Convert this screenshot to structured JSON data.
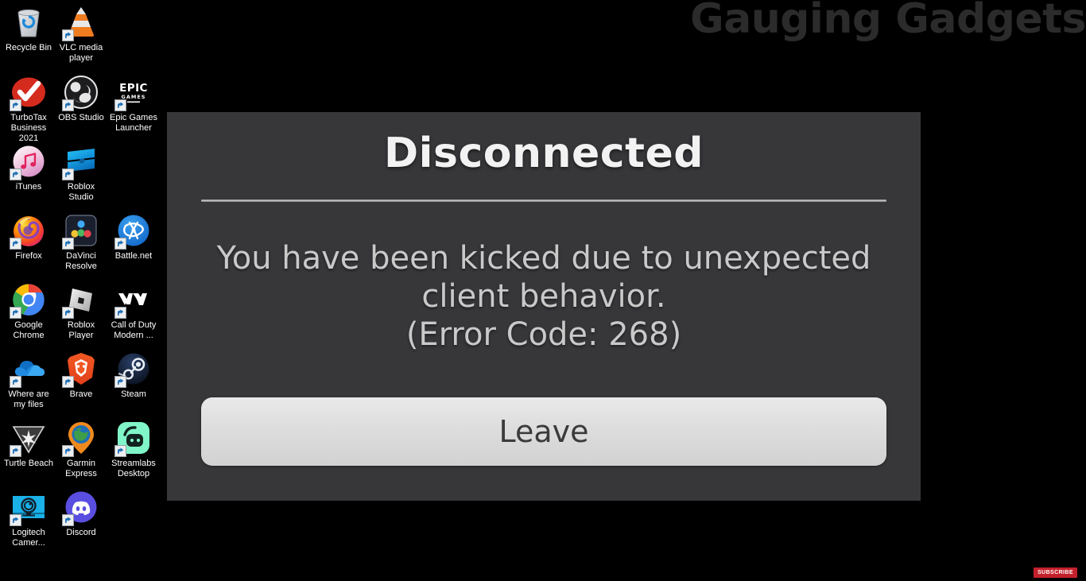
{
  "watermark": {
    "text": "Gauging Gadgets"
  },
  "desktop": {
    "icons": [
      {
        "label": "Recycle Bin",
        "art": "recycle-bin",
        "shortcut": false,
        "col": 0,
        "row": 0
      },
      {
        "label": "VLC media player",
        "art": "vlc",
        "shortcut": true,
        "col": 1,
        "row": 0
      },
      {
        "label": "TurboTax Business 2021",
        "art": "turbotax",
        "shortcut": true,
        "col": 0,
        "row": 1
      },
      {
        "label": "OBS Studio",
        "art": "obs",
        "shortcut": true,
        "col": 1,
        "row": 1
      },
      {
        "label": "Epic Games Launcher",
        "art": "epic-games",
        "shortcut": true,
        "col": 2,
        "row": 1
      },
      {
        "label": "iTunes",
        "art": "itunes",
        "shortcut": true,
        "col": 0,
        "row": 2
      },
      {
        "label": "Roblox Studio",
        "art": "roblox-studio",
        "shortcut": true,
        "col": 1,
        "row": 2
      },
      {
        "label": "Firefox",
        "art": "firefox",
        "shortcut": true,
        "col": 0,
        "row": 3
      },
      {
        "label": "DaVinci Resolve",
        "art": "davinci-resolve",
        "shortcut": true,
        "col": 1,
        "row": 3
      },
      {
        "label": "Battle.net",
        "art": "battle-net",
        "shortcut": true,
        "col": 2,
        "row": 3
      },
      {
        "label": "Google Chrome",
        "art": "chrome",
        "shortcut": true,
        "col": 0,
        "row": 4
      },
      {
        "label": "Roblox Player",
        "art": "roblox-player",
        "shortcut": true,
        "col": 1,
        "row": 4
      },
      {
        "label": "Call of Duty Modern ...",
        "art": "call-of-duty",
        "shortcut": true,
        "col": 2,
        "row": 4
      },
      {
        "label": "Where are my files",
        "art": "onedrive",
        "shortcut": true,
        "col": 0,
        "row": 5
      },
      {
        "label": "Brave",
        "art": "brave",
        "shortcut": true,
        "col": 1,
        "row": 5
      },
      {
        "label": "Steam",
        "art": "steam",
        "shortcut": true,
        "col": 2,
        "row": 5
      },
      {
        "label": "Turtle Beach",
        "art": "turtle-beach",
        "shortcut": true,
        "col": 0,
        "row": 6
      },
      {
        "label": "Garmin Express",
        "art": "garmin-express",
        "shortcut": true,
        "col": 1,
        "row": 6
      },
      {
        "label": "Streamlabs Desktop",
        "art": "streamlabs",
        "shortcut": true,
        "col": 2,
        "row": 6
      },
      {
        "label": "Logitech Camer...",
        "art": "logitech-camera",
        "shortcut": true,
        "col": 0,
        "row": 7
      },
      {
        "label": "Discord",
        "art": "discord",
        "shortcut": true,
        "col": 1,
        "row": 7
      }
    ]
  },
  "dialog": {
    "title": "Disconnected",
    "message": "You have been kicked due to unexpected client behavior.",
    "error_code": "(Error Code: 268)",
    "leave_label": "Leave",
    "background_color": "#37373a",
    "button_color": "#dcdcdc"
  },
  "overlay": {
    "subscribe_label": "SUBSCRIBE",
    "subscribe_color": "#c4202b"
  }
}
